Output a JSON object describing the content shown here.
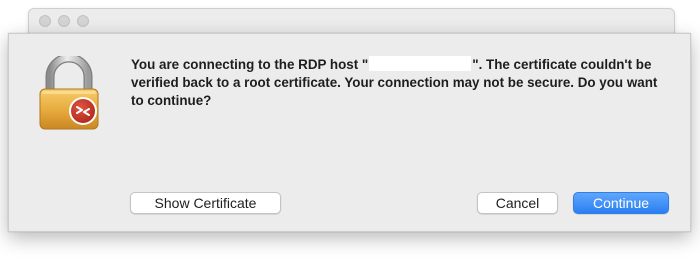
{
  "dialog": {
    "message_before_host": "You are connecting to the RDP host \"",
    "message_host": "",
    "message_after_host": "\". The certificate couldn't be verified back to a root certificate. Your connection may not be secure. Do you want to continue?"
  },
  "buttons": {
    "show_certificate": "Show Certificate",
    "cancel": "Cancel",
    "continue": "Continue"
  },
  "icons": {
    "main": "lock-icon",
    "badge": "remote-desktop-icon"
  },
  "colors": {
    "accent": "#2b7ff3",
    "lock_gold": "#e0a537",
    "badge_red": "#c8382a"
  }
}
